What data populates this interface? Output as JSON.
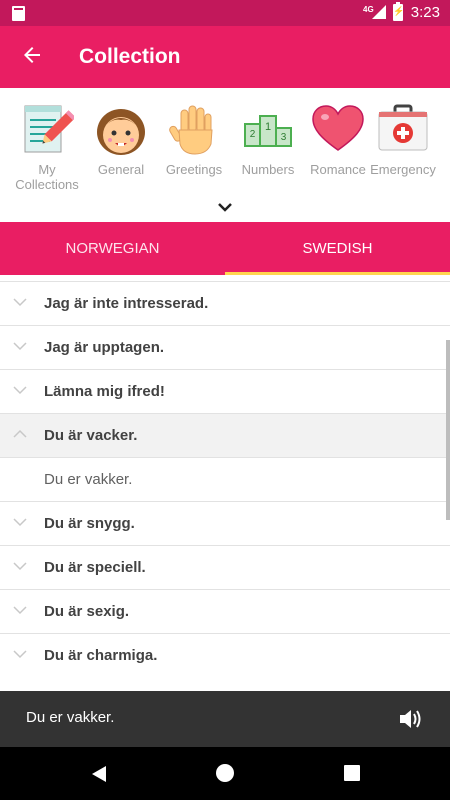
{
  "status_bar": {
    "time": "3:23",
    "network": "4G"
  },
  "app_bar": {
    "title": "Collection"
  },
  "categories": [
    {
      "label": "My Collections",
      "icon": "notepad-icon"
    },
    {
      "label": "General",
      "icon": "child-face-icon"
    },
    {
      "label": "Greetings",
      "icon": "waving-hand-icon"
    },
    {
      "label": "Numbers",
      "icon": "podium-icon"
    },
    {
      "label": "Romance",
      "icon": "heart-icon"
    },
    {
      "label": "Emergency",
      "icon": "first-aid-kit-icon"
    }
  ],
  "tabs": {
    "left": "NORWEGIAN",
    "right": "SWEDISH",
    "selected": "SWEDISH"
  },
  "phrases": [
    {
      "text": "Jag är inte intresserad.",
      "expanded": false
    },
    {
      "text": "Jag är upptagen.",
      "expanded": false
    },
    {
      "text": "Lämna mig ifred!",
      "expanded": false
    },
    {
      "text": "Du är vacker.",
      "expanded": true,
      "translation": "Du er vakker."
    },
    {
      "text": "Du är snygg.",
      "expanded": false
    },
    {
      "text": "Du är speciell.",
      "expanded": false
    },
    {
      "text": "Du är sexig.",
      "expanded": false
    },
    {
      "text": "Du är charmiga.",
      "expanded": false
    }
  ],
  "player": {
    "text": "Du er vakker.",
    "icon": "speaker-icon"
  },
  "colors": {
    "primary": "#e91e63",
    "status_bar": "#c2185b",
    "tab_indicator": "#ffd54f",
    "player_bg": "#333333"
  }
}
